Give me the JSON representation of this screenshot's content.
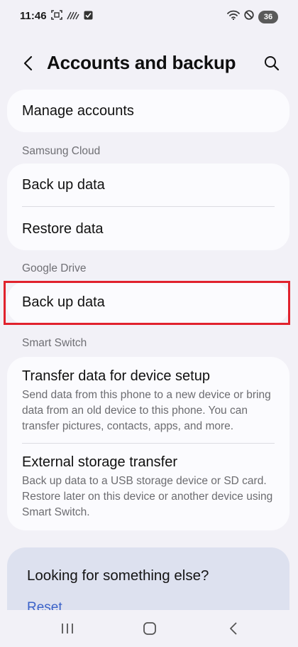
{
  "status_bar": {
    "time": "11:46",
    "battery": "36",
    "icons": [
      "screenshot-icon",
      "nfc-icon",
      "checkbox-icon",
      "wifi-icon",
      "dnd-icon"
    ]
  },
  "header": {
    "title": "Accounts and backup",
    "back_icon": "back-arrow-icon",
    "search_icon": "search-icon"
  },
  "manage_accounts": {
    "label": "Manage accounts"
  },
  "samsung_cloud": {
    "section_title": "Samsung Cloud",
    "items": [
      {
        "label": "Back up data"
      },
      {
        "label": "Restore data"
      }
    ]
  },
  "google_drive": {
    "section_title": "Google Drive",
    "items": [
      {
        "label": "Back up data"
      }
    ]
  },
  "smart_switch": {
    "section_title": "Smart Switch",
    "items": [
      {
        "label": "Transfer data for device setup",
        "description": "Send data from this phone to a new device or bring data from an old device to this phone. You can transfer pictures, contacts, apps, and more."
      },
      {
        "label": "External storage transfer",
        "description": "Back up data to a USB storage device or SD card. Restore later on this device or another device using Smart Switch."
      }
    ]
  },
  "suggestions": {
    "title": "Looking for something else?",
    "link": "Reset"
  },
  "nav": {
    "recents_icon": "recents-icon",
    "home_icon": "home-icon",
    "back_icon": "back-icon"
  },
  "colors": {
    "background": "#f2f1f7",
    "card": "#fbfbfe",
    "suggestion_card": "#dde1ef",
    "link": "#3a62c9",
    "highlight": "#e1222d"
  }
}
